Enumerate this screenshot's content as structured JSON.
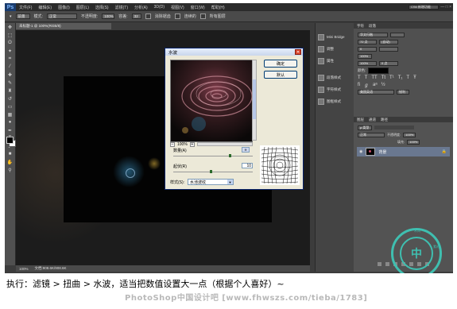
{
  "app": {
    "logo": "Ps",
    "menus": [
      "文件(F)",
      "编辑(E)",
      "图像(I)",
      "图层(L)",
      "选择(S)",
      "滤镜(T)",
      "分析(A)",
      "3D(D)",
      "视图(V)",
      "窗口(W)",
      "帮助(H)"
    ],
    "workspace": "CS6 新增功能",
    "window_controls": "— □ ×"
  },
  "options_bar": {
    "mode_label": "模式:",
    "mode_value": "正常",
    "opacity_label": "不透明度:",
    "opacity_value": "100%",
    "tolerance_label": "容差:",
    "tolerance_value": "32",
    "antialias_label": "消除锯齿",
    "contiguous_label": "连续的",
    "all_layers_label": "所有图层"
  },
  "document": {
    "tab": "未标题-1 @ 100%(RGB/8)",
    "zoom": "100%",
    "status": "文档:908.6K/908.6K"
  },
  "dock": {
    "items": [
      "Mini Bridge",
      "调整",
      "属性",
      "段落样式",
      "字符样式",
      "图框样式"
    ]
  },
  "char_panel": {
    "tabs": [
      "字符",
      "段落"
    ],
    "font_family": "华文行楷",
    "font_size": "72 点",
    "leading": "(自动)",
    "tracking": "0",
    "scale_v": "100%",
    "scale_h": "100%",
    "baseline": "0 点",
    "color_label": "颜色:",
    "language": "美国英语",
    "aa": "锐利"
  },
  "layers_panel": {
    "tabs": [
      "图层",
      "通道",
      "路径"
    ],
    "blend_mode": "正常",
    "opacity_label": "不透明度:",
    "opacity_value": "100%",
    "fill_label": "填充:",
    "fill_value": "100%",
    "layer_name": "背景"
  },
  "dialog": {
    "title": "水波",
    "ok": "确定",
    "reset": "默认",
    "zoom": "100%",
    "amount_label": "数量(A)",
    "amount_value": "37",
    "ridges_label": "起伏(R)",
    "ridges_value": "10",
    "style_label": "样式(S):",
    "style_value": "水池波纹"
  },
  "watermark": {
    "center": "中",
    "text_top": "木风",
    "text_side": "素材"
  },
  "caption": "执行：滤镜 > 扭曲 > 水波，适当把数值设置大一点（根据个人喜好）~",
  "footer_watermark": "PhotoShop中国设计吧 [www.fhwszs.com/tieba/1783]"
}
